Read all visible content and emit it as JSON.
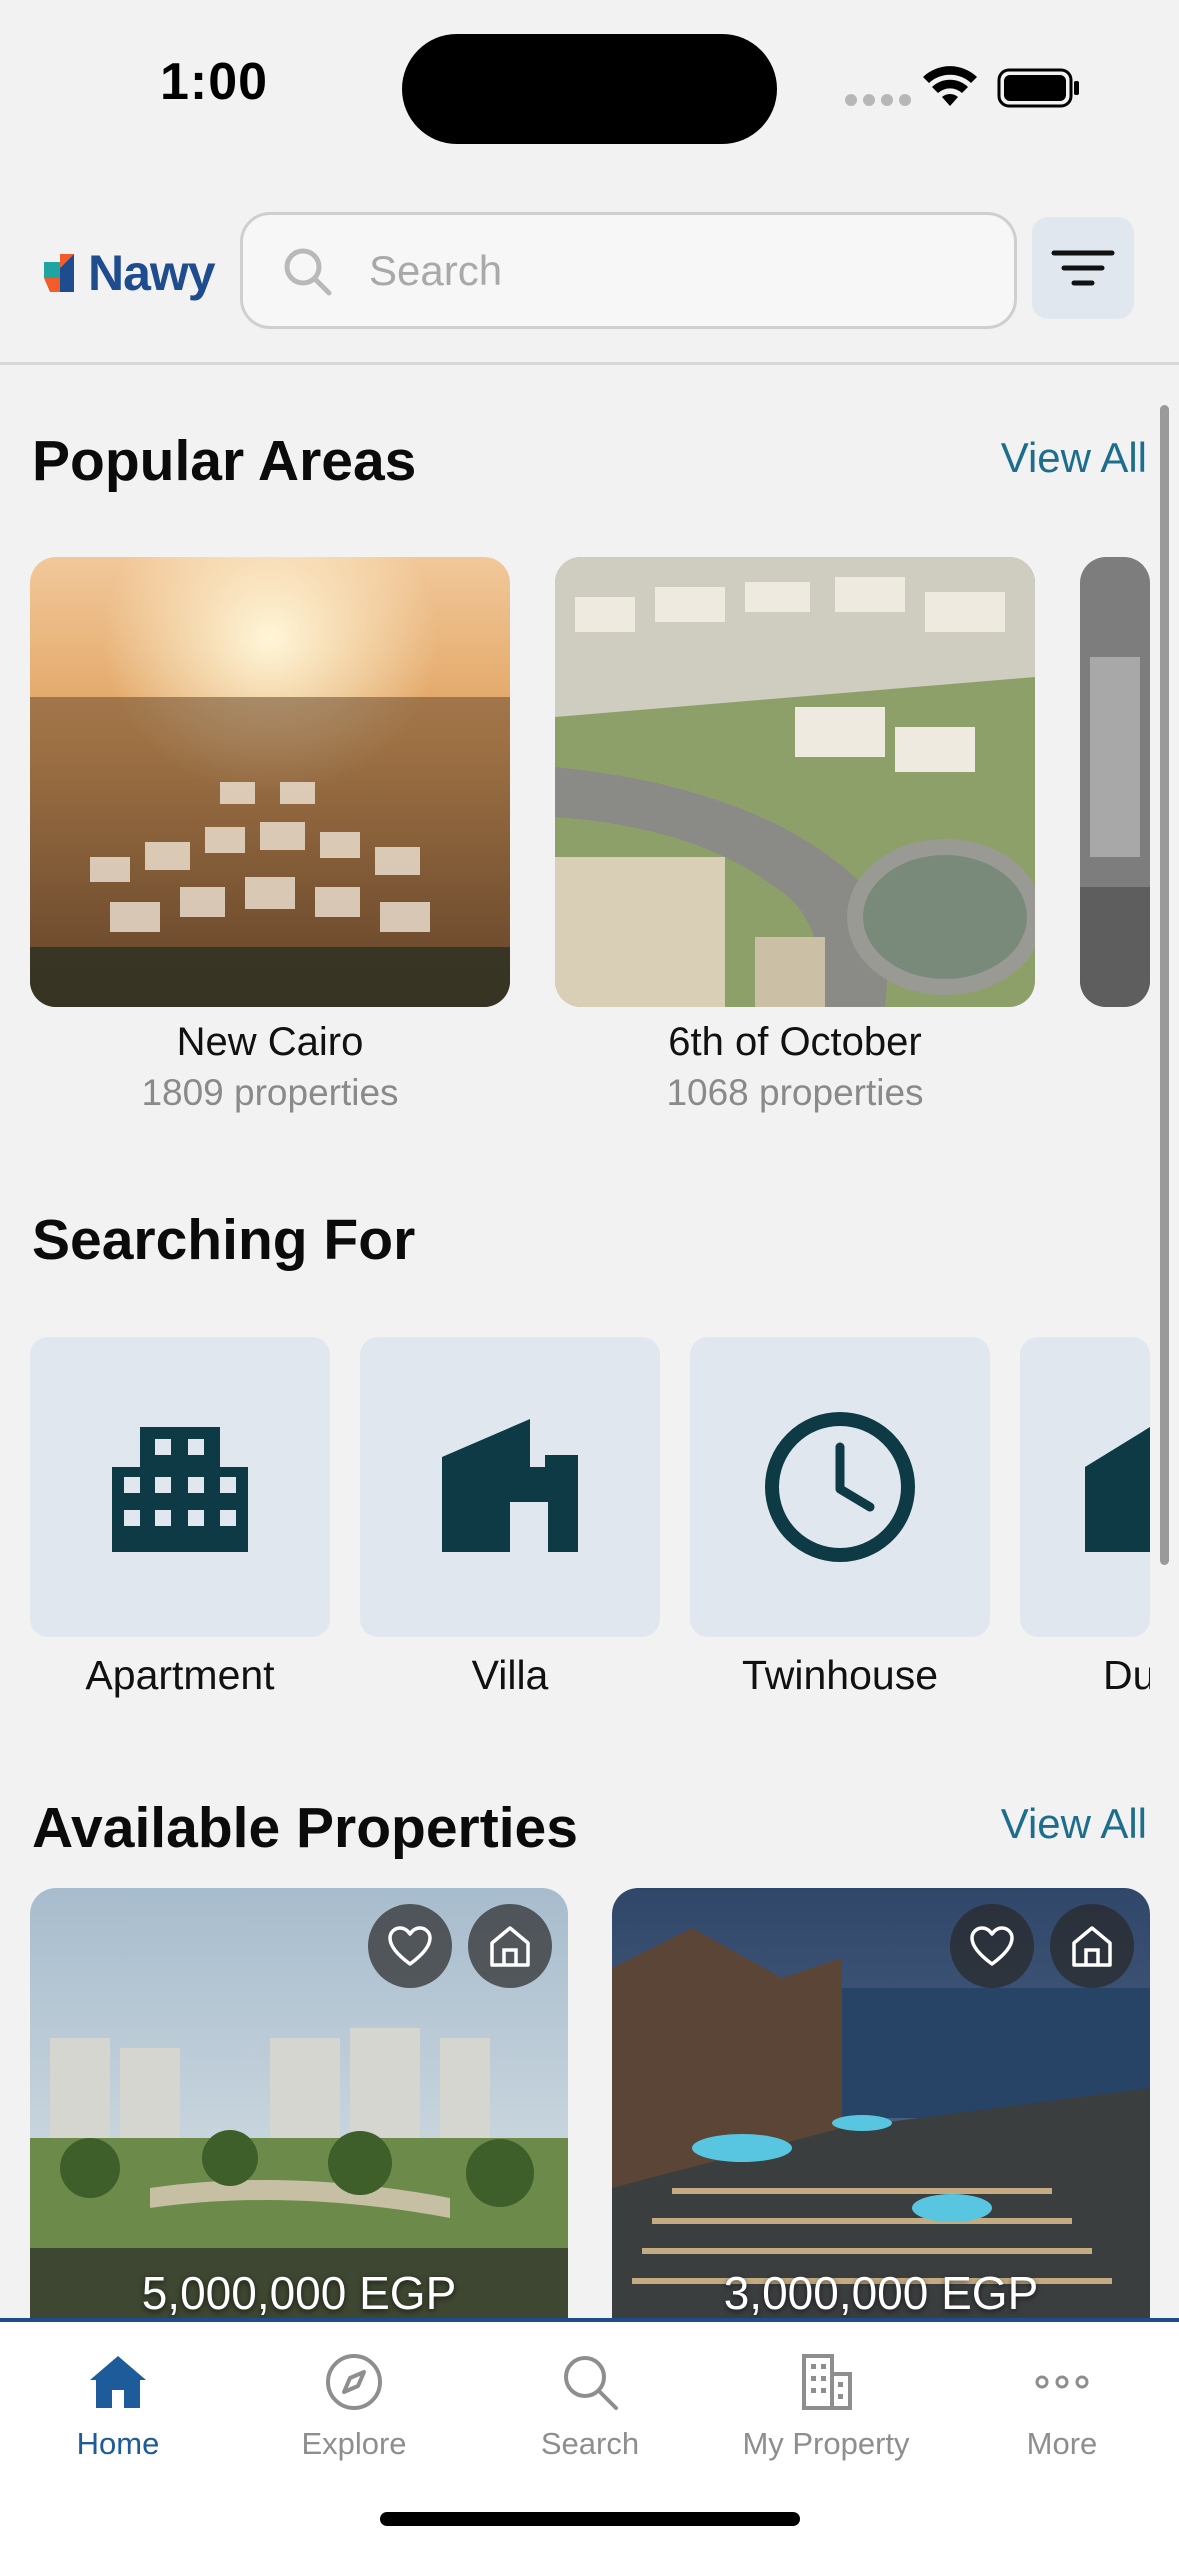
{
  "status_bar": {
    "time": "1:00"
  },
  "header": {
    "logo_text": "Nawy",
    "search_placeholder": "Search"
  },
  "popular_areas": {
    "title": "Popular Areas",
    "view_all": "View All",
    "items": [
      {
        "name": "New Cairo",
        "count": "1809 properties"
      },
      {
        "name": "6th of October",
        "count": "1068 properties"
      }
    ]
  },
  "searching_for": {
    "title": "Searching For",
    "items": [
      {
        "label": "Apartment",
        "icon": "apartment-building-icon"
      },
      {
        "label": "Villa",
        "icon": "villa-icon"
      },
      {
        "label": "Twinhouse",
        "icon": "clock-icon"
      },
      {
        "label": "Du",
        "icon": "duplex-icon"
      }
    ]
  },
  "available_properties": {
    "title": "Available Properties",
    "view_all": "View All",
    "items": [
      {
        "price": "5,000,000 EGP"
      },
      {
        "price": "3,000,000 EGP"
      }
    ]
  },
  "tab_bar": {
    "items": [
      {
        "label": "Home",
        "icon": "home-icon",
        "active": true
      },
      {
        "label": "Explore",
        "icon": "compass-icon",
        "active": false
      },
      {
        "label": "Search",
        "icon": "search-icon",
        "active": false
      },
      {
        "label": "My Property",
        "icon": "building-icon",
        "active": false
      },
      {
        "label": "More",
        "icon": "more-dots-icon",
        "active": false
      }
    ]
  },
  "colors": {
    "brand_blue": "#1f4b8f",
    "link": "#1d6e8c",
    "tile_bg": "#e0e7ef",
    "icon_dark": "#0d3a44"
  }
}
